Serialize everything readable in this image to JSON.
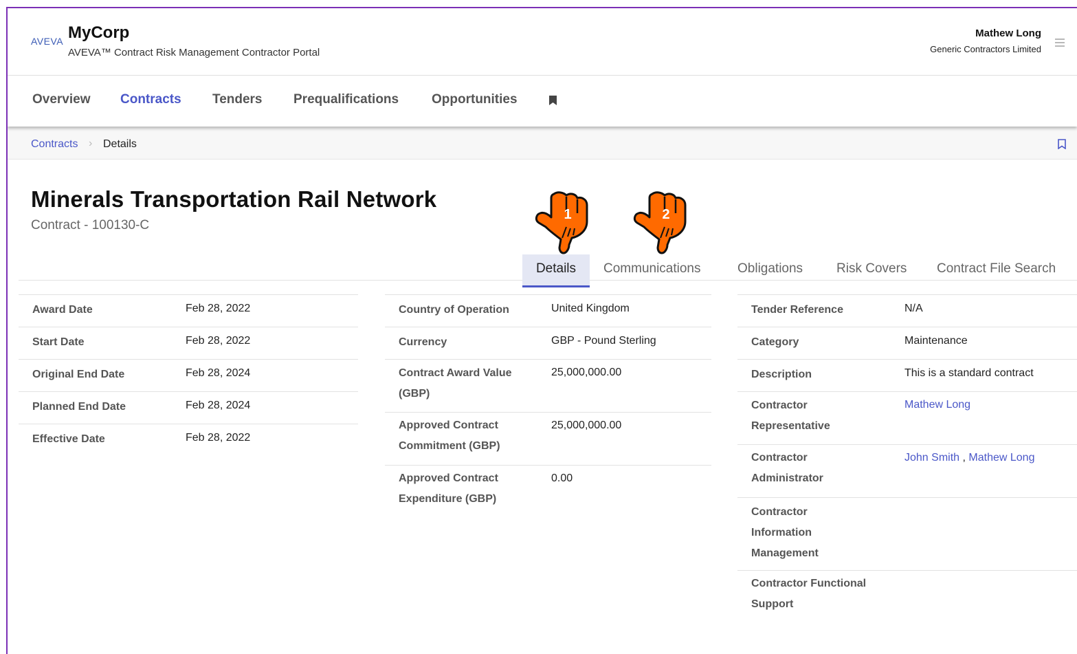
{
  "header": {
    "logo": "AVEVA",
    "app_name": "MyCorp",
    "app_subtitle": "AVEVA™ Contract Risk Management Contractor Portal",
    "user_name": "Mathew Long",
    "user_org": "Generic Contractors Limited"
  },
  "nav": {
    "items": [
      {
        "label": "Overview"
      },
      {
        "label": "Contracts"
      },
      {
        "label": "Tenders"
      },
      {
        "label": "Prequalifications"
      },
      {
        "label": "Opportunities"
      }
    ],
    "active": "Contracts",
    "bookmark_icon": "bookmark-icon"
  },
  "breadcrumb": {
    "link": "Contracts",
    "separator": "›",
    "current": "Details"
  },
  "contract": {
    "title": "Minerals Transportation Rail Network",
    "subtitle": "Contract - 100130-C"
  },
  "tabs": [
    {
      "label": "Details"
    },
    {
      "label": "Communications"
    },
    {
      "label": "Obligations"
    },
    {
      "label": "Risk Covers"
    },
    {
      "label": "Contract File Search"
    }
  ],
  "active_tab": "Details",
  "pointers": [
    {
      "number": "1"
    },
    {
      "number": "2"
    }
  ],
  "columns": {
    "left": [
      {
        "label": "Award Date",
        "value": "Feb 28, 2022"
      },
      {
        "label": "Start Date",
        "value": "Feb 28, 2022"
      },
      {
        "label": "Original End Date",
        "value": "Feb 28, 2024"
      },
      {
        "label": "Planned End Date",
        "value": "Feb 28, 2024"
      },
      {
        "label": "Effective Date",
        "value": "Feb 28, 2022"
      }
    ],
    "middle": [
      {
        "label": "Country of Operation",
        "value": "United Kingdom"
      },
      {
        "label": "Currency",
        "value": "GBP - Pound Sterling"
      },
      {
        "label": "Contract Award Value (GBP)",
        "value": "25,000,000.00"
      },
      {
        "label": "Approved Contract Commitment (GBP)",
        "value": "25,000,000.00"
      },
      {
        "label": "Approved Contract Expenditure (GBP)",
        "value": "0.00"
      }
    ],
    "right": [
      {
        "label": "Tender Reference",
        "value": "N/A"
      },
      {
        "label": "Category",
        "value": "Maintenance"
      },
      {
        "label": "Description",
        "value": "This is a standard contract"
      },
      {
        "label": "Contractor Representative",
        "links": [
          "Mathew Long"
        ]
      },
      {
        "label": "Contractor Administrator",
        "links": [
          "John Smith",
          "Mathew Long"
        ],
        "link_separator": ","
      },
      {
        "label": "Contractor Information Management",
        "value": ""
      },
      {
        "label": "Contractor Functional Support",
        "value": ""
      }
    ]
  },
  "colors": {
    "accent": "#4a57c8",
    "frame": "#7b2fb6",
    "pointer": "#ff6a00"
  }
}
